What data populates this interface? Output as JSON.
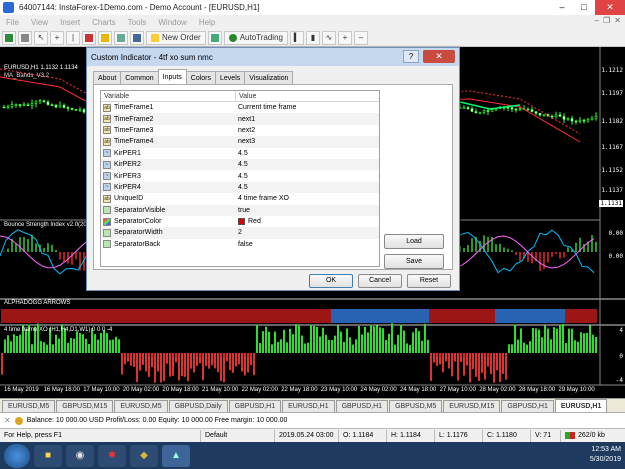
{
  "window": {
    "title": "64007144: InstaForex-1Demo.com - Demo Account - [EURUSD,H1]"
  },
  "menu": [
    "File",
    "View",
    "Insert",
    "Charts",
    "Tools",
    "Window",
    "Help"
  ],
  "toolbar": {
    "new_order": "New Order",
    "autotrading": "AutoTrading"
  },
  "chart": {
    "main_title": "EURUSD,H1  1.1132 1.1134",
    "indicator_label": "MA_Bands_V3.2",
    "prices": [
      "1.1212",
      "1.1197",
      "1.1182",
      "1.1167",
      "1.1152",
      "1.1137",
      "1.1131"
    ],
    "bsi_title": "Bounce Strength Index v2.0(20",
    "bsi_levels": [
      "0.00",
      "0.00"
    ],
    "alpha_title": "ALPHADOGG ARROWS",
    "xo_title": "4 time frame XO (H1,H4,D1,W1) 0 0 0 -4",
    "xo_levels": [
      "4",
      "0",
      "-4"
    ],
    "times": [
      "16 May 2019",
      "16 May 18:00",
      "17 May 10:00",
      "20 May 02:00",
      "20 May 18:00",
      "21 May 10:00",
      "22 May 02:00",
      "22 May 18:00",
      "23 May 10:00",
      "24 May 02:00",
      "24 May 18:00",
      "27 May 10:00",
      "28 May 02:00",
      "28 May 18:00",
      "29 May 10:00"
    ]
  },
  "chart_tabs": [
    "EURUSD,M5",
    "GBPUSD,M15",
    "EURUSD,M5",
    "GBPUSD,Daily",
    "GBPUSD,H1",
    "EURUSD,H1",
    "GBPUSD,H1",
    "GBPUSD,M5",
    "EURUSD,M15",
    "GBPUSD,H1",
    "EURUSD,H1"
  ],
  "balance": "Balance: 10 000.00 USD  Profit/Loss: 0.00  Equity: 10 000.00  Free margin: 10 000.00",
  "status": {
    "help": "For Help, press F1",
    "profile": "Default",
    "datetime": "2019.05.24 03:00",
    "open": "O: 1.1184",
    "high": "H: 1.1184",
    "low": "L: 1.1176",
    "close": "C: 1.1180",
    "volume": "V: 71",
    "traffic": "262/0 kb"
  },
  "tray": {
    "time": "12:53 AM",
    "date": "5/30/2019"
  },
  "dialog": {
    "title": "Custom Indicator - 4tf xo sum nmc",
    "help": "?",
    "tabs": [
      "About",
      "Common",
      "Inputs",
      "Colors",
      "Levels",
      "Visualization"
    ],
    "active_tab": "Inputs",
    "col_variable": "Variable",
    "col_value": "Value",
    "rows": [
      {
        "icon": "ab",
        "variable": "TimeFrame1",
        "value": "Current time frame"
      },
      {
        "icon": "ab",
        "variable": "TimeFrame2",
        "value": "next1"
      },
      {
        "icon": "ab",
        "variable": "TimeFrame3",
        "value": "next2"
      },
      {
        "icon": "ab",
        "variable": "TimeFrame4",
        "value": "next3"
      },
      {
        "icon": "wv",
        "variable": "KirPER1",
        "value": "4.5"
      },
      {
        "icon": "wv",
        "variable": "KirPER2",
        "value": "4.5"
      },
      {
        "icon": "wv",
        "variable": "KirPER3",
        "value": "4.5"
      },
      {
        "icon": "wv",
        "variable": "KirPER4",
        "value": "4.5"
      },
      {
        "icon": "ab",
        "variable": "UniqueID",
        "value": "4 time frame XO"
      },
      {
        "icon": "gr",
        "variable": "SeparatorVisible",
        "value": "true"
      },
      {
        "icon": "cl",
        "variable": "SeparatorColor",
        "value": "Red",
        "swatch": "#e00000"
      },
      {
        "icon": "gr",
        "variable": "SeparatorWidth",
        "value": "2"
      },
      {
        "icon": "gr",
        "variable": "SeparatorBack",
        "value": "false"
      }
    ],
    "load": "Load",
    "save": "Save",
    "ok": "OK",
    "cancel": "Cancel",
    "reset": "Reset"
  }
}
